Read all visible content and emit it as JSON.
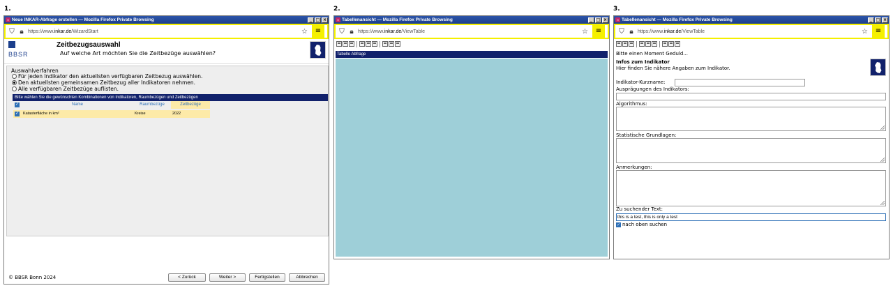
{
  "steps": [
    "1.",
    "2.",
    "3."
  ],
  "window1": {
    "title": "Neue INKAR-Abfrage erstellen — Mozilla Firefox Private Browsing",
    "url_prefix": "https://www.",
    "url_domain": "inkar.de",
    "url_path": "/WizardStart",
    "logo_text": "BBSR",
    "heading": "Zeitbezugsauswahl",
    "subheading": "Auf welche Art möchten Sie die Zeitbezüge auswählen?",
    "group_label": "Auswahlverfahren",
    "options": [
      {
        "label": "Für jeden Indikator den aktuellsten verfügbaren Zeitbezug auswählen.",
        "selected": false
      },
      {
        "label": "Den aktuellsten gemeinsamen Zeitbezug aller Indikatoren nehmen.",
        "selected": true
      },
      {
        "label": "Alle verfügbaren Zeitbezüge auflisten.",
        "selected": false
      }
    ],
    "table_caption": "Bitte wählen Sie die gewünschten Kombinationen von Indikatoren, Raumbezügen und Zeitbezügen",
    "columns": [
      "Name",
      "Raumbezüge",
      "Zeitbezüge"
    ],
    "rows": [
      {
        "name": "Katasterfläche in km²",
        "raum": "Kreise",
        "zeit": "2022"
      }
    ],
    "copyright": "© BBSR Bonn 2024",
    "buttons": {
      "back": "< Zurück",
      "next": "Weiter >",
      "finish": "Fertigstellen",
      "cancel": "Abbrechen"
    }
  },
  "window2": {
    "title": "Tabellenansicht — Mozilla Firefox Private Browsing",
    "url_prefix": "https://www.",
    "url_domain": "inkar.de",
    "url_path": "/ViewTable",
    "bar_title": "Tabelle Abfrage"
  },
  "window3": {
    "title": "Tabellenansicht — Mozilla Firefox Private Browsing",
    "url_prefix": "https://www.",
    "url_domain": "inkar.de",
    "url_path": "/ViewTable",
    "wait_text": "Bitte einen Moment Geduld...",
    "info_title": "Infos zum Indikator",
    "info_sub": "Hier finden Sie nähere Angaben zum Indikator.",
    "short_name_label": "Indikator-Kurzname:",
    "short_name_value": "",
    "auspraegungen_label": "Ausprägungen des Indikators:",
    "algorithmus_label": "Algorithmus:",
    "statistik_label": "Statistische Grundlagen:",
    "anmerkungen_label": "Anmerkungen:",
    "search_label": "Zu suchender Text:",
    "search_value": "this is a test, this is only a test",
    "search_up_label": "nach oben suchen",
    "search_up_checked": true
  }
}
